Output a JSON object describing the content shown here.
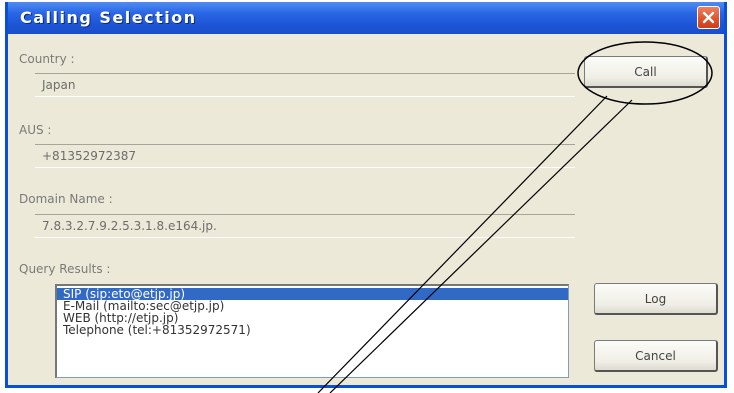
{
  "window": {
    "title": "Calling Selection"
  },
  "country": {
    "label": "Country :",
    "value": "Japan"
  },
  "aus": {
    "label": "AUS :",
    "value": "+81352972387"
  },
  "domain": {
    "label": "Domain Name :",
    "value": "7.8.3.2.7.9.2.5.3.1.8.e164.jp."
  },
  "query": {
    "label": "Query Results :",
    "items": [
      "SIP (sip:eto@etjp.jp)",
      "E-Mail (mailto:sec@etjp.jp)",
      "WEB (http://etjp.jp)",
      "Telephone (tel:+81352972571)"
    ],
    "selected_index": 0
  },
  "buttons": {
    "call": "Call",
    "log": "Log",
    "cancel": "Cancel"
  },
  "icons": {
    "close": "close-icon"
  },
  "colors": {
    "titlebar": "#1d55d6",
    "selection": "#316ac5",
    "close": "#e0502a"
  }
}
